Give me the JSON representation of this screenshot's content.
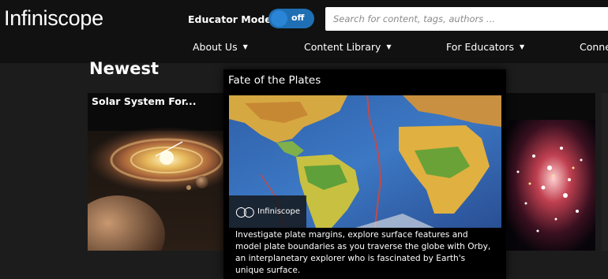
{
  "header": {
    "logo": "Infiniscope",
    "educator_mode_label": "Educator Mode",
    "toggle_state": "off",
    "search_placeholder": "Search for content, tags, authors ..."
  },
  "nav": [
    {
      "label": "About Us"
    },
    {
      "label": "Content Library"
    },
    {
      "label": "For Educators"
    },
    {
      "label": "Conne"
    }
  ],
  "main": {
    "section_title": "Newest",
    "cards": [
      {
        "title": "Solar System For..."
      }
    ],
    "featured": {
      "title": "Fate of the Plates",
      "brand": "Infiniscope",
      "description": "Investigate plate margins, explore surface features and model plate boundaries as you traverse the globe with Orby, an interplanetary explorer who is fascinated by Earth's unique surface."
    }
  },
  "colors": {
    "background": "#1c1c1c",
    "topbar": "#111111",
    "toggle": "#1f6fb4"
  }
}
